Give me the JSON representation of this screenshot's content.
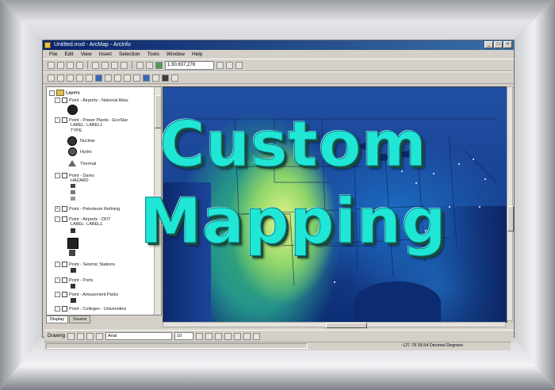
{
  "headline": {
    "line1": "Custom",
    "line2": "Mapping"
  },
  "window": {
    "title": "Untitled.mxd - ArcMap - ArcInfo",
    "buttons": [
      "_",
      "□",
      "×"
    ]
  },
  "menu": [
    "File",
    "Edit",
    "View",
    "Insert",
    "Selection",
    "Tools",
    "Window",
    "Help"
  ],
  "toolbar": {
    "scale_value": "1:30,637,278"
  },
  "toc": {
    "root": "Layers",
    "rows": [
      "Point - Airports - National Atlas",
      "Point - Power Plants - EcoStar",
      "LABEL: LABEL1",
      "TYPE",
      "Nuclear",
      "Hydro",
      "Thermal",
      "Point - Dams",
      "HAZARD",
      "Point - Petroleum Refining",
      "Point - Airports - DOT",
      "LABEL: LABEL1",
      "Point - Seismic Stations",
      "Point - Ports",
      "Point - Amusement Parks",
      "Point - Colleges - Universities"
    ],
    "tabs": [
      "Display",
      "Source"
    ]
  },
  "drawbar": {
    "label": "Drawing",
    "font": "Arial",
    "size": "10"
  },
  "status": {
    "coords": "-127.78  39.54 Decimal Degrees"
  },
  "colors": {
    "headline": "#20e6d6",
    "titlebar": "#0a246a",
    "map_ocean": "#173f8e"
  }
}
